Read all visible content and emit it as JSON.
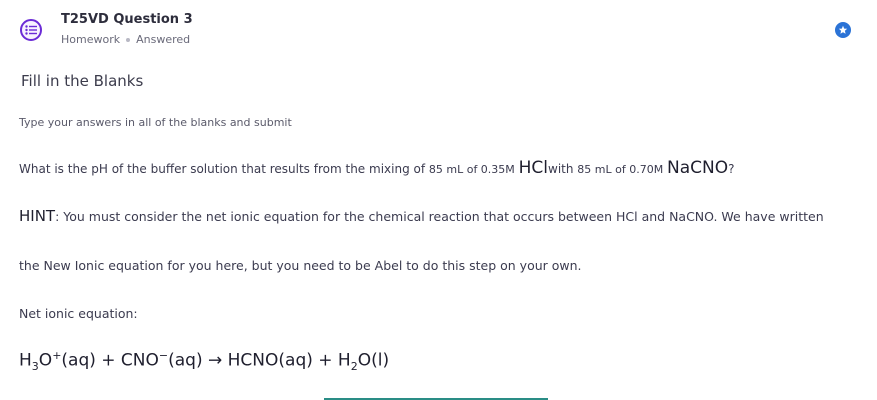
{
  "header": {
    "title": "T25VD Question 3",
    "type": "Homework",
    "status": "Answered",
    "accent_color": "#6b2bd6",
    "badge_color": "#2b73d6"
  },
  "section_title": "Fill in the Blanks",
  "instructions": "Type your answers in all of the blanks and submit",
  "question": {
    "part1": "What is the pH of the  buffer solution that results from the mixing of ",
    "vol1": "85 mL of 0.35M",
    "acid": "HCl",
    "part2": "with ",
    "vol2": "85 mL of 0.70M",
    "salt": "NaCNO",
    "end": "?"
  },
  "hint": {
    "label": "HINT",
    "line1": ": You must consider the net ionic equation for the chemical reaction that occurs between HCl and NaCNO. We have written",
    "line2": "the New Ionic equation for you here, but you need to be Abel to do this step on your own."
  },
  "net_label": "Net ionic equation:",
  "equation": {
    "h": "H",
    "h_sub": "3",
    "o": "O",
    "o_sup": "+",
    "aq1": "(aq) + CNO",
    "minus": "−",
    "aq2": "(aq) → HCNO(aq) + H",
    "h2_sub": "2",
    "water": "O(l)"
  }
}
